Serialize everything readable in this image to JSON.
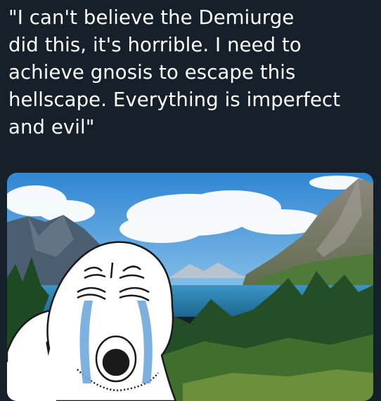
{
  "tweet": {
    "text": "\"I can't believe the Demiurge\ndid this, it's horrible. I need to\nachieve gnosis to escape this\nhellscape. Everything is imperfect\nand evil\""
  },
  "image": {
    "scene": "mountain-lake-landscape",
    "overlay": "crying-wojak-face"
  },
  "colors": {
    "background": "#15202b",
    "text": "#ffffff",
    "sky": "#3a8fd6",
    "lake": "#2e7fb0",
    "forest": "#1f4d22",
    "tears": "#6fa8dc"
  }
}
